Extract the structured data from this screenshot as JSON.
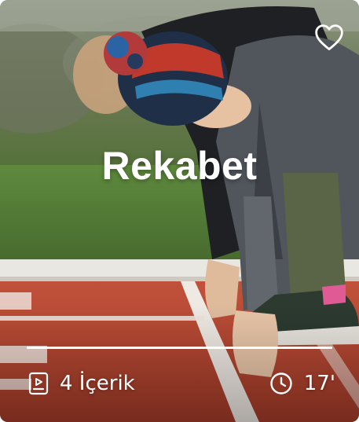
{
  "card": {
    "title": "Rekabet",
    "favorite_icon": "heart-outline-icon",
    "content_icon": "video-playlist-icon",
    "content_count_label": "4 İçerik",
    "duration_icon": "clock-icon",
    "duration_label": "17'",
    "progress_fraction": 1.0
  },
  "colors": {
    "text": "#ffffff",
    "track_surface": "#b8452f",
    "grass": "#4b6f34"
  }
}
